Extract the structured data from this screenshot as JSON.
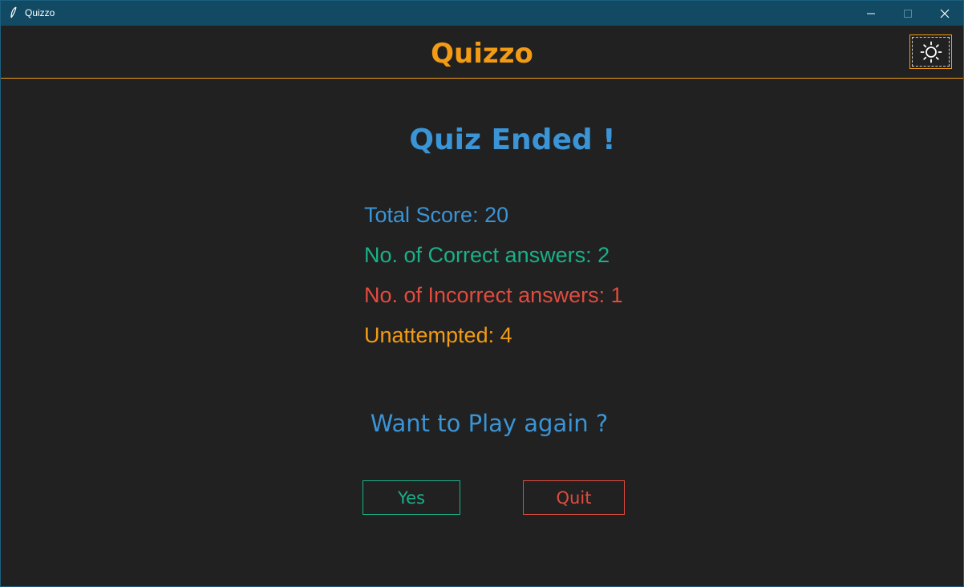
{
  "window": {
    "title": "Quizzo",
    "icon": "feather-icon",
    "controls": [
      "minimize-icon",
      "maximize-icon",
      "close-icon"
    ]
  },
  "header": {
    "app_title": "Quizzo",
    "theme_toggle_icon": "sun-icon"
  },
  "result": {
    "heading": "Quiz Ended !",
    "total_score": "Total Score: 20",
    "correct": "No. of Correct answers: 2",
    "incorrect": "No. of Incorrect answers: 1",
    "unattempted": "Unattempted: 4"
  },
  "prompt": {
    "question": "Want to Play again ?",
    "yes_label": "Yes",
    "quit_label": "Quit"
  },
  "colors": {
    "background": "#212121",
    "titlebar": "#124a63",
    "accent_orange": "#f29b14",
    "blue": "#3a94d6",
    "green": "#1ab088",
    "red": "#e24b3f"
  }
}
